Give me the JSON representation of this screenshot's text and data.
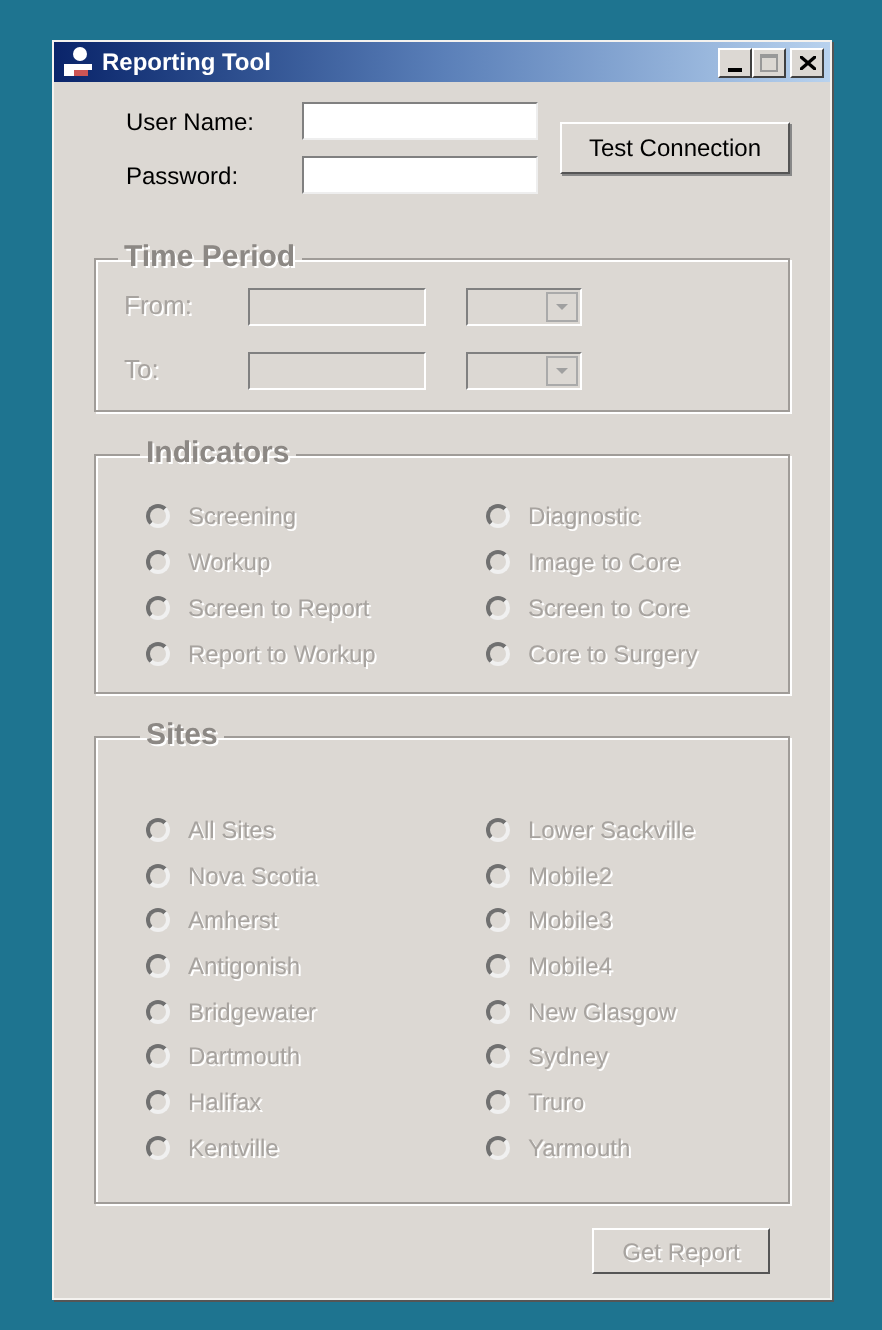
{
  "window": {
    "title": "Reporting Tool"
  },
  "login": {
    "fields": [
      {
        "label": "User Name:"
      },
      {
        "label": "Password:"
      }
    ],
    "test_button": "Test Connection"
  },
  "time_period": {
    "title": "Time Period",
    "disabled": true,
    "rows": [
      {
        "label": "From:"
      },
      {
        "label": "To:"
      }
    ]
  },
  "indicators": {
    "title": "Indicators",
    "options": [
      {
        "label": "Screening",
        "selected": false,
        "disabled": true
      },
      {
        "label": "Diagnostic",
        "selected": false,
        "disabled": true
      },
      {
        "label": "Workup",
        "selected": false,
        "disabled": true
      },
      {
        "label": "Image to Core",
        "selected": false,
        "disabled": true
      },
      {
        "label": "Screen to Report",
        "selected": false,
        "disabled": true
      },
      {
        "label": "Screen to Core",
        "selected": false,
        "disabled": true
      },
      {
        "label": "Report to Workup",
        "selected": false,
        "disabled": true
      },
      {
        "label": "Core to Surgery",
        "selected": false,
        "disabled": true
      }
    ]
  },
  "sites": {
    "title": "Sites",
    "options": [
      {
        "label": "All Sites",
        "selected": false,
        "disabled": true
      },
      {
        "label": "Lower Sackville",
        "selected": false,
        "disabled": true
      },
      {
        "label": "Nova Scotia",
        "selected": false,
        "disabled": true
      },
      {
        "label": "Mobile2",
        "selected": false,
        "disabled": true
      },
      {
        "label": "Amherst",
        "selected": false,
        "disabled": true
      },
      {
        "label": "Mobile3",
        "selected": false,
        "disabled": true
      },
      {
        "label": "Antigonish",
        "selected": false,
        "disabled": true
      },
      {
        "label": "Mobile4",
        "selected": false,
        "disabled": true
      },
      {
        "label": "Bridgewater",
        "selected": false,
        "disabled": true
      },
      {
        "label": "New Glasgow",
        "selected": false,
        "disabled": true
      },
      {
        "label": "Dartmouth",
        "selected": false,
        "disabled": true
      },
      {
        "label": "Sydney",
        "selected": false,
        "disabled": true
      },
      {
        "label": "Halifax",
        "selected": false,
        "disabled": true
      },
      {
        "label": "Truro",
        "selected": false,
        "disabled": true
      },
      {
        "label": "Kentville",
        "selected": false,
        "disabled": true
      },
      {
        "label": "Yarmouth",
        "selected": false,
        "disabled": true
      }
    ]
  },
  "get_report": {
    "label": "Get Report",
    "disabled": true
  }
}
